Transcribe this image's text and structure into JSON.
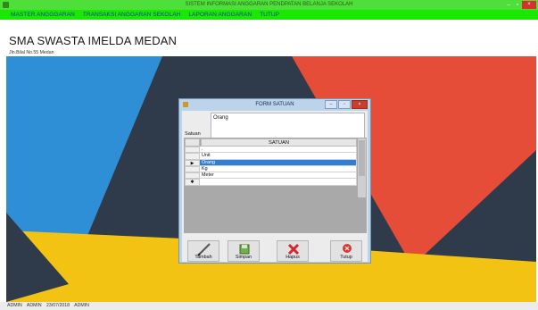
{
  "window": {
    "title": "SISTEM INFORMASI ANGGARAN PENDPATAN BELANJA SEKOLAH",
    "controls": [
      "–",
      "▫",
      "×"
    ]
  },
  "menu": [
    "MASTER ANGGGARAN",
    "TRANSAKSI ANGGARAN SEKOLAH",
    "LAPORAN ANGGARAN",
    "TUTUP"
  ],
  "header": {
    "school_name": "SMA SWASTA IMELDA MEDAN",
    "address": "Jln.Bilal No.55 Medan"
  },
  "form": {
    "title": "FORM SATUAN",
    "field_label": "Satuan",
    "field_value": "Orang",
    "grid": {
      "column": "SATUAN",
      "rows": [
        {
          "marker": "",
          "value": "."
        },
        {
          "marker": "",
          "value": "Unit"
        },
        {
          "marker": "▶",
          "value": "Orang",
          "selected": true
        },
        {
          "marker": "",
          "value": "Kg"
        },
        {
          "marker": "",
          "value": "Meter"
        },
        {
          "marker": "✱",
          "value": ""
        }
      ]
    },
    "buttons": {
      "tambah": "Tambah",
      "simpan": "Simpan",
      "hapus": "Hapus",
      "tutup": "Tutup"
    }
  },
  "status": [
    "ADMIN",
    "ADMIN",
    "23/07/2018",
    "ADMIN"
  ],
  "colors": {
    "menubar": "#19e800",
    "titlebar": "#4fdf3a",
    "menu_text": "#1e3ea8",
    "selection": "#2f7fd9"
  },
  "icons": {
    "tambah": "pen-icon",
    "simpan": "save-icon",
    "hapus": "delete-x-icon",
    "tutup": "close-circle-icon"
  }
}
